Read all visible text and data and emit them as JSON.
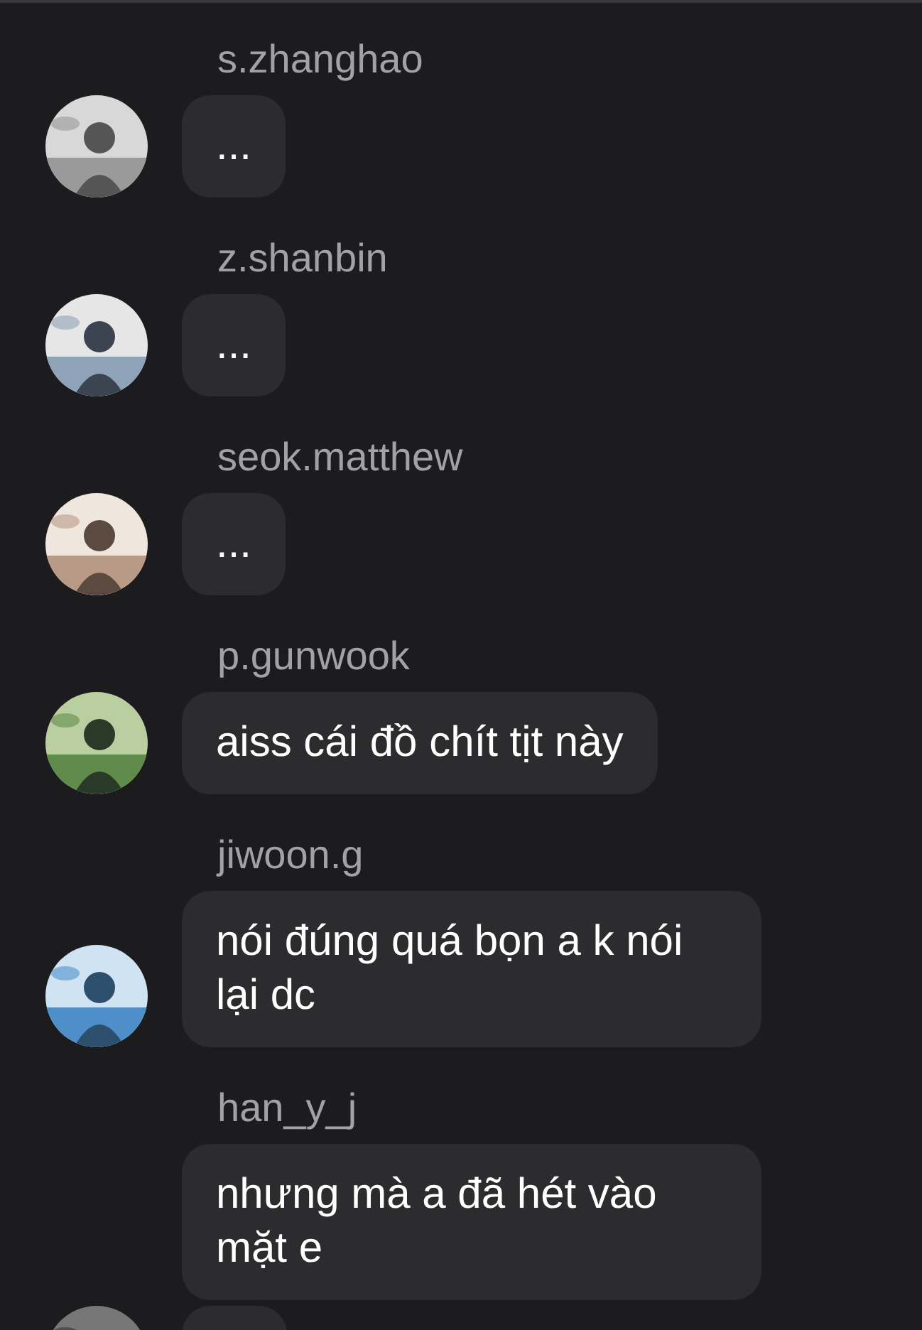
{
  "messages": [
    {
      "username": "s.zhanghao",
      "bubbles": [
        "..."
      ]
    },
    {
      "username": "z.shanbin",
      "bubbles": [
        "..."
      ]
    },
    {
      "username": "seok.matthew",
      "bubbles": [
        "..."
      ]
    },
    {
      "username": "p.gunwook",
      "bubbles": [
        "aiss cái đồ chít tịt này"
      ]
    },
    {
      "username": "jiwoon.g",
      "bubbles": [
        "nói đúng quá bọn a k nói lại dc"
      ]
    },
    {
      "username": "han_y_j",
      "bubbles": [
        "nhưng mà a đã hét vào mặt e"
      ],
      "cut_bubble": true
    }
  ]
}
